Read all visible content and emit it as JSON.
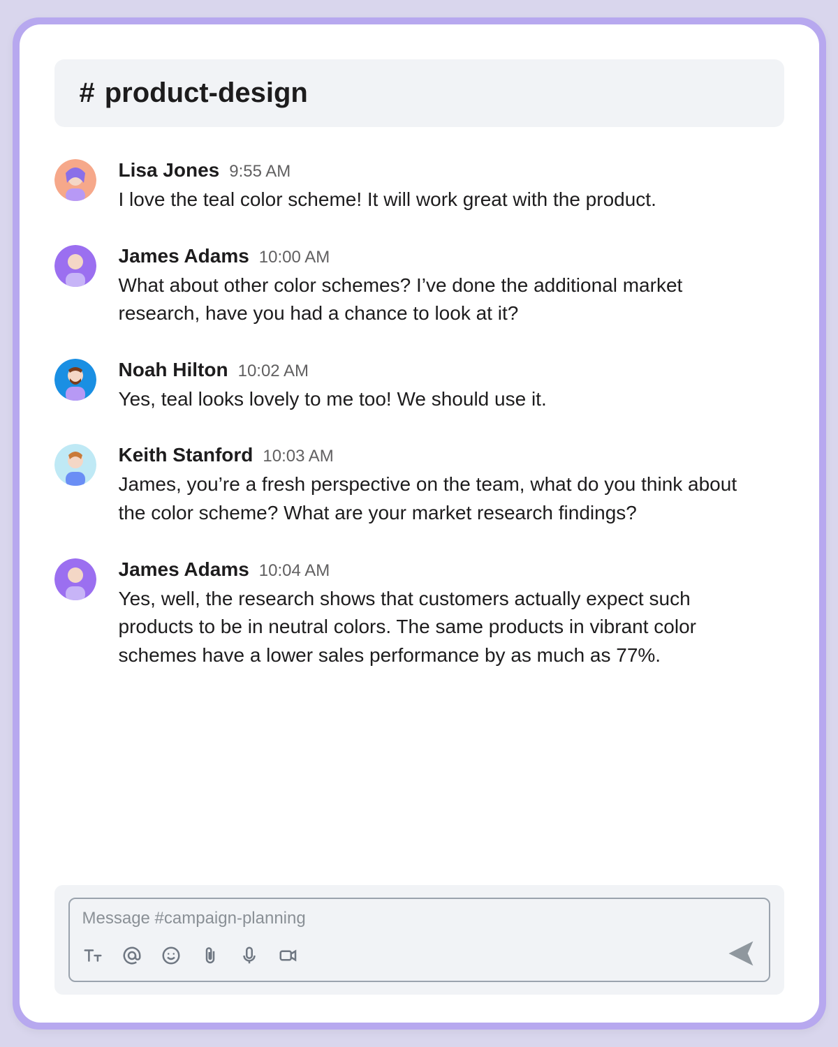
{
  "channel": {
    "hash": "#",
    "name": "product-design"
  },
  "messages": [
    {
      "author": "Lisa Jones",
      "time": "9:55 AM",
      "text": "I love the teal color scheme! It will work great with the product.",
      "avatar_bg": "#f6a88a",
      "avatar_name": "avatar-lisa"
    },
    {
      "author": "James Adams",
      "time": "10:00 AM",
      "text": "What about other color schemes? I’ve done the additional market research, have you had a chance to look at it?",
      "avatar_bg": "#9b6ff0",
      "avatar_name": "avatar-james"
    },
    {
      "author": "Noah Hilton",
      "time": "10:02 AM",
      "text": "Yes, teal looks lovely to me too! We should use it.",
      "avatar_bg": "#1a8fe3",
      "avatar_name": "avatar-noah"
    },
    {
      "author": "Keith Stanford",
      "time": "10:03 AM",
      "text": "James, you’re a fresh perspective on the team, what do you think about the color scheme? What are your market research findings?",
      "avatar_bg": "#bfe9f5",
      "avatar_name": "avatar-keith"
    },
    {
      "author": "James Adams",
      "time": "10:04 AM",
      "text": "Yes, well, the research shows that customers actually expect such products to be in neutral colors. The same products in vibrant color schemes have a lower sales performance by as much as 77%.",
      "avatar_bg": "#9b6ff0",
      "avatar_name": "avatar-james"
    }
  ],
  "composer": {
    "placeholder": "Message #campaign-planning"
  },
  "icons": {
    "format": "format-icon",
    "mention": "mention-icon",
    "emoji": "emoji-icon",
    "attach": "attachment-icon",
    "mic": "microphone-icon",
    "video": "video-icon",
    "send": "send-icon"
  }
}
